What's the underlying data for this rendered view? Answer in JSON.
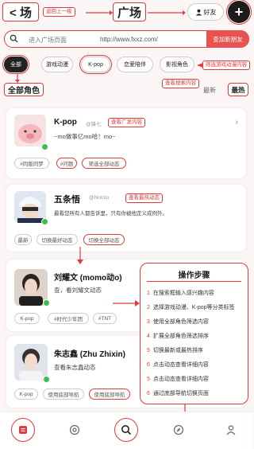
{
  "header": {
    "back_label": "< 场",
    "title": "广场",
    "friends_label": "好友",
    "plus_label": "+",
    "ann_back": "返回上一级"
  },
  "search": {
    "placeholder": "进入广场页面",
    "url": "http://www.fxxz.com/",
    "add_friend_label": "查加新朋友"
  },
  "tabs": [
    "全部",
    "游戏动漫",
    "K-pop",
    "恋爱陪伴",
    "影视角色"
  ],
  "ann_filter": "筛选游戏动漫内容",
  "ann_filter_tab": "选择",
  "all_roles_label": "全部角色",
  "ann_search_content": "查看搜索内容",
  "sort": {
    "latest": "最新",
    "hot": "最热"
  },
  "cards": [
    {
      "name": "K-pop",
      "handle": "@锋七",
      "desc": "~mo做事亿mo哈！mo~",
      "tags": [
        "#同版同梦",
        "#问题",
        "筛选全部动态"
      ],
      "ann": "查看广发内容"
    },
    {
      "name": "五条悟",
      "handle": "@Nonito",
      "desc": "最看您所有人都告诉里，只有你被他定义成例外。",
      "tags": [
        "最新",
        "切换最好动态",
        "切换全部动态"
      ],
      "ann": "查看最热动态"
    },
    {
      "name": "刘耀文 (momo动o)",
      "desc": "查，看刘耀文动态",
      "tags": [
        "K-pop",
        "#时代少年团",
        "#TNT"
      ]
    },
    {
      "name": "朱志鑫 (Zhu Zhixin)",
      "desc": "查看朱志鑫动态",
      "tags": [
        "K-pop",
        "使用底部导航",
        "使用底部导航"
      ]
    }
  ],
  "steps": {
    "title": "操作步骤",
    "items": [
      {
        "n": "1",
        "text": "在搜索框输入感兴趣内容"
      },
      {
        "n": "2",
        "text": "选择游戏动漫、K-pop等分类标签"
      },
      {
        "n": "3",
        "text": "使用全部角色筛选内容"
      },
      {
        "n": "4",
        "text": "扩展全部角色筛选排序"
      },
      {
        "n": "5",
        "text": "切换最新或最热排序"
      },
      {
        "n": "6",
        "text": "点击动态查看详细内容"
      },
      {
        "n": "5",
        "text": "点击动态查看详细内容"
      },
      {
        "n": "6",
        "text": "通过底部导航切换页面"
      }
    ]
  },
  "nav_icons": [
    "home-icon",
    "at-icon",
    "search-icon",
    "compass-icon",
    "profile-icon"
  ],
  "colors": {
    "accent": "#e23a3a",
    "brand": "#e9524e",
    "dark": "#1d1d1d"
  }
}
